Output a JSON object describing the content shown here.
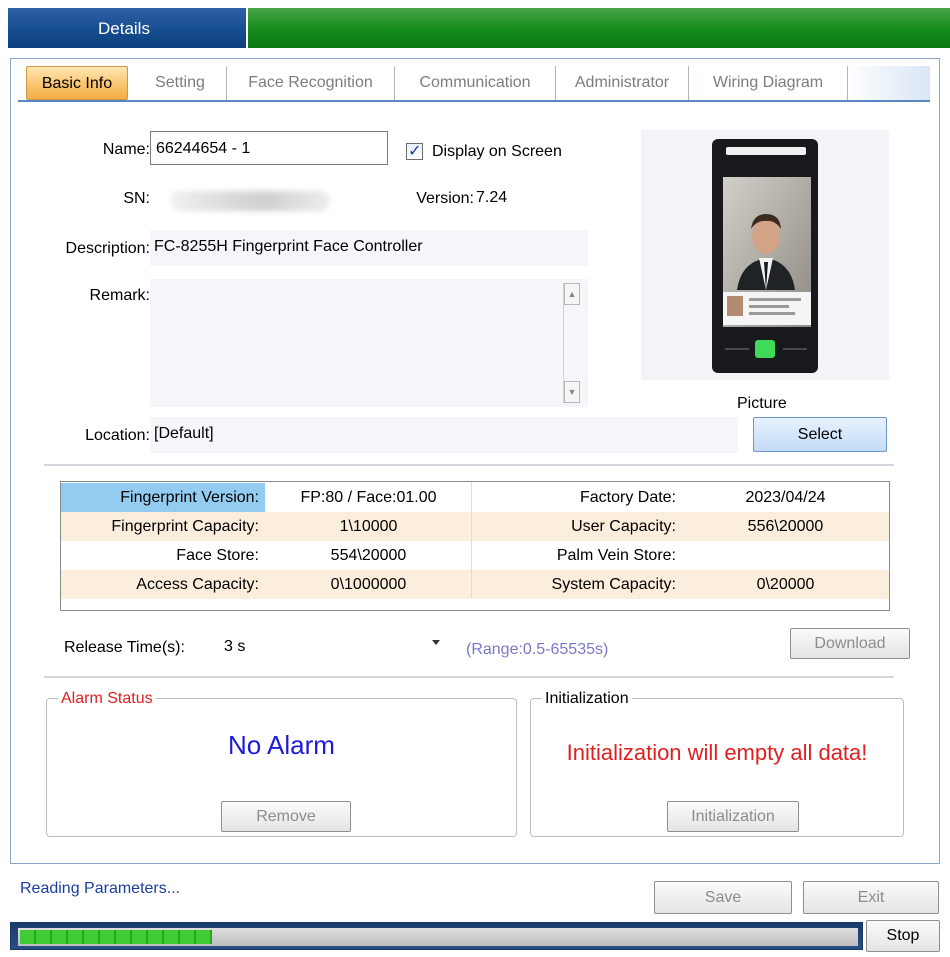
{
  "window": {
    "title": "Details"
  },
  "tabs": [
    {
      "label": "Basic Info",
      "active": true
    },
    {
      "label": "Setting",
      "active": false
    },
    {
      "label": "Face Recognition",
      "active": false
    },
    {
      "label": "Communication",
      "active": false
    },
    {
      "label": "Administrator",
      "active": false
    },
    {
      "label": "Wiring Diagram",
      "active": false
    }
  ],
  "basic": {
    "name_label": "Name:",
    "name_value": "66244654 - 1",
    "display_on_screen_label": "Display on Screen",
    "display_on_screen_checked": true,
    "sn_label": "SN:",
    "version_label": "Version:",
    "version_value": "7.24",
    "description_label": "Description:",
    "description_value": "FC-8255H Fingerprint Face Controller",
    "remark_label": "Remark:",
    "remark_value": "",
    "location_label": "Location:",
    "location_value": "[Default]",
    "picture_label": "Picture",
    "select_button": "Select"
  },
  "info_table": {
    "rows": [
      [
        "Fingerprint Version:",
        "FP:80 / Face:01.00",
        "Factory Date:",
        "2023/04/24"
      ],
      [
        "Fingerprint Capacity:",
        "1\\10000",
        "User Capacity:",
        "556\\20000"
      ],
      [
        "Face Store:",
        "554\\20000",
        "Palm Vein Store:",
        ""
      ],
      [
        "Access Capacity:",
        "0\\1000000",
        "System Capacity:",
        "0\\20000"
      ]
    ]
  },
  "release": {
    "label": "Release Time(s):",
    "value": "3 s",
    "range_text": "(Range:0.5-65535s)",
    "download_button": "Download"
  },
  "alarm": {
    "title": "Alarm Status",
    "status": "No Alarm",
    "remove_button": "Remove"
  },
  "initialization": {
    "title": "Initialization",
    "warning": "Initialization will empty all data!",
    "button": "Initialization"
  },
  "footer": {
    "status": "Reading Parameters...",
    "save_button": "Save",
    "exit_button": "Exit",
    "stop_button": "Stop",
    "progress": 0.23
  },
  "colors": {
    "title_blue": "#154c8e",
    "title_green": "#148a1c",
    "alarm_red": "#e02020",
    "no_alarm_blue": "#1c1cd6",
    "range_text": "#7a78c8",
    "status_text": "#1b3fa0",
    "row_alt": "#fbeedd",
    "cell_highlight": "#94ccf1"
  }
}
